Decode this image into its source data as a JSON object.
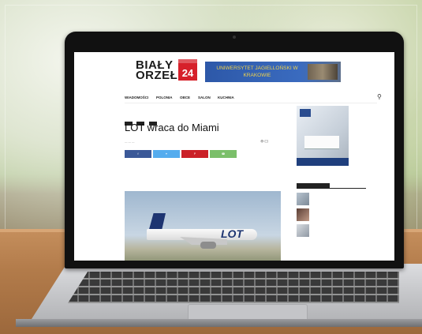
{
  "site": {
    "logo_line1": "BIAŁY",
    "logo_line2": "ORZEŁ",
    "logo_badge": "24",
    "banner_text": "UNIWERSYTET JAGIELLOŃSKI W KRAKOWIE"
  },
  "nav": {
    "items": [
      "WIADOMOŚCI",
      "POLONIA",
      "OBCE",
      "SALON",
      "KUCHNIA"
    ]
  },
  "article": {
    "breadcrumb": "",
    "title": "LOT wraca do Miami",
    "share_buttons": [
      {
        "color": "#3b5998"
      },
      {
        "color": "#55acee"
      },
      {
        "color": "#cb2027"
      },
      {
        "color": "#7bbf6a"
      }
    ],
    "lead": "",
    "hero_text": "LOT"
  },
  "sidebar": {
    "ad_caption": "",
    "popular_heading": "",
    "popular_items": [
      {
        "text": "",
        "date": ""
      },
      {
        "text": "",
        "date": ""
      },
      {
        "text": "",
        "date": ""
      }
    ]
  },
  "colors": {
    "brand_red": "#d6202a",
    "brand_blue": "#1d3471"
  }
}
